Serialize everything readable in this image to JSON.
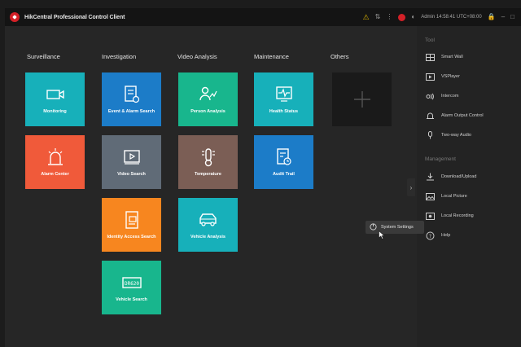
{
  "app": {
    "title": "HikCentral Professional Control Client",
    "user_text": "Admin  14:58:41 UTC+08:00"
  },
  "columns": [
    "Surveillance",
    "Investigation",
    "Video Analysis",
    "Maintenance",
    "Others"
  ],
  "tiles": {
    "monitoring": "Monitoring",
    "alarm_center": "Alarm Center",
    "event_alarm_search": "Event & Alarm Search",
    "video_search": "Video Search",
    "identity_access_search": "Identity Access Search",
    "vehicle_search": "Vehicle Search",
    "person_analysis": "Person Analysis",
    "temperature": "Temperature",
    "vehicle_analysis": "Vehicle Analysis",
    "health_status": "Health Status",
    "audit_trail": "Audit Trail"
  },
  "right_panel": {
    "tools_heading": "Tool",
    "tools": [
      "Smart Wall",
      "VSPlayer",
      "Intercom",
      "Alarm Output Control",
      "Two-way Audio"
    ],
    "management_heading": "Management",
    "management": [
      "Download/Upload",
      "Local Picture",
      "Local Recording",
      "Help"
    ],
    "system_settings": "System Settings"
  },
  "colors": {
    "teal": "#17b0ba",
    "blue": "#1c7cc8",
    "green": "#18b68d",
    "red": "#f05a3a",
    "gray": "#606b77",
    "brown": "#7b5e55",
    "orange": "#f7861f"
  }
}
